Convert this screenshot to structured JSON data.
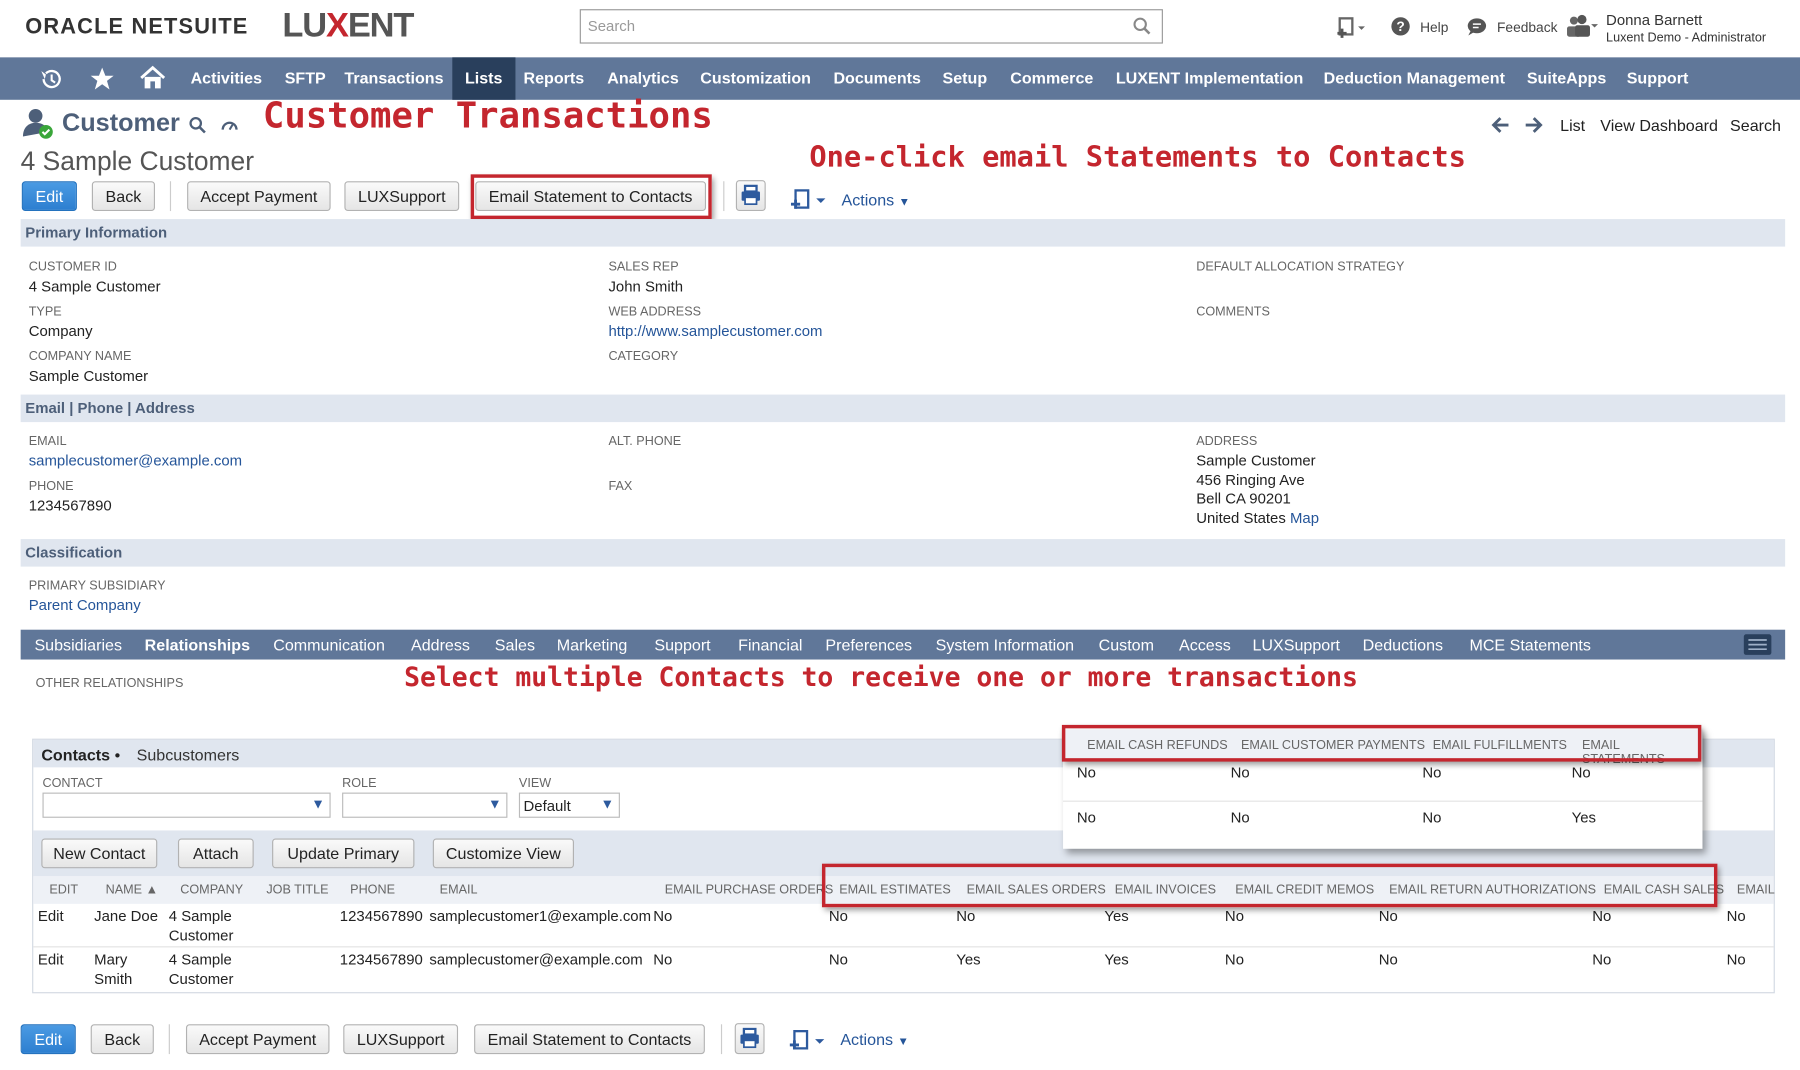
{
  "brand": {
    "oracle": "ORACLE NETSUITE",
    "luxent_pre": "LU",
    "luxent_x": "X",
    "luxent_post": "ENT"
  },
  "search": {
    "placeholder": "Search"
  },
  "topbar": {
    "help": "Help",
    "feedback": "Feedback",
    "user_name": "Donna Barnett",
    "user_role": "Luxent Demo - Administrator"
  },
  "nav": [
    "Activities",
    "SFTP",
    "Transactions",
    "Lists",
    "Reports",
    "Analytics",
    "Customization",
    "Documents",
    "Setup",
    "Commerce",
    "LUXENT Implementation",
    "Deduction Management",
    "SuiteApps",
    "Support"
  ],
  "nav_selected": "Lists",
  "annotations": {
    "title": "Customer Transactions",
    "email_button": "One-click email Statements to Contacts",
    "contacts": "Select multiple Contacts to  receive one or more transactions"
  },
  "page": {
    "type": "Customer",
    "record": "4 Sample Customer"
  },
  "page_links": {
    "list": "List",
    "dashboard": "View Dashboard",
    "search": "Search"
  },
  "buttons": {
    "edit": "Edit",
    "back": "Back",
    "accept": "Accept Payment",
    "luxsupport": "LUXSupport",
    "email_statement": "Email Statement to Contacts",
    "actions": "Actions"
  },
  "primary": {
    "section": "Primary Information",
    "customer_id_label": "CUSTOMER ID",
    "customer_id": "4 Sample Customer",
    "type_label": "TYPE",
    "type": "Company",
    "company_name_label": "COMPANY NAME",
    "company_name": "Sample Customer",
    "sales_rep_label": "SALES REP",
    "sales_rep": "John Smith",
    "web_label": "WEB ADDRESS",
    "web": "http://www.samplecustomer.com",
    "category_label": "CATEGORY",
    "alloc_label": "DEFAULT ALLOCATION STRATEGY",
    "comments_label": "COMMENTS"
  },
  "contact_info": {
    "section": "Email | Phone | Address",
    "email_label": "EMAIL",
    "email": "samplecustomer@example.com",
    "phone_label": "PHONE",
    "phone": "1234567890",
    "alt_phone_label": "ALT. PHONE",
    "fax_label": "FAX",
    "address_label": "ADDRESS",
    "address_1": "Sample Customer",
    "address_2": "456 Ringing Ave",
    "address_3": "Bell CA 90201",
    "address_4": "United States",
    "map": "Map"
  },
  "classification": {
    "section": "Classification",
    "subsidiary_label": "PRIMARY SUBSIDIARY",
    "subsidiary": "Parent Company"
  },
  "subtabs": [
    "Subsidiaries",
    "Relationships",
    "Communication",
    "Address",
    "Sales",
    "Marketing",
    "Support",
    "Financial",
    "Preferences",
    "System Information",
    "Custom",
    "Access",
    "LUXSupport",
    "Deductions",
    "MCE Statements"
  ],
  "subtab_selected": "Relationships",
  "other_relationships": "OTHER RELATIONSHIPS",
  "contacts_tabs": {
    "contacts": "Contacts",
    "dot": "•",
    "subcustomers": "Subcustomers"
  },
  "filters": {
    "contact_label": "CONTACT",
    "role_label": "ROLE",
    "view_label": "VIEW",
    "view_value": "Default"
  },
  "contact_buttons": {
    "new": "New Contact",
    "attach": "Attach",
    "update_primary": "Update Primary",
    "customize": "Customize View"
  },
  "columns": [
    "EDIT",
    "NAME ▲",
    "COMPANY",
    "JOB TITLE",
    "PHONE",
    "EMAIL",
    "EMAIL PURCHASE ORDERS",
    "EMAIL ESTIMATES",
    "EMAIL SALES ORDERS",
    "EMAIL INVOICES",
    "EMAIL CREDIT MEMOS",
    "EMAIL RETURN AUTHORIZATIONS",
    "EMAIL CASH SALES",
    "EMAIL"
  ],
  "rows": [
    {
      "edit": "Edit",
      "name1": "Jane Doe",
      "name2": "",
      "company1": "4 Sample",
      "company2": "Customer",
      "phone": "1234567890",
      "email": "samplecustomer1@example.com",
      "po": "No",
      "est": "No",
      "so": "No",
      "inv": "Yes",
      "cm": "No",
      "ra": "No",
      "cs": "No",
      "last": "No"
    },
    {
      "edit": "Edit",
      "name1": "Mary",
      "name2": "Smith",
      "company1": "4 Sample",
      "company2": "Customer",
      "phone": "1234567890",
      "email": "samplecustomer@example.com",
      "po": "No",
      "est": "No",
      "so": "Yes",
      "inv": "Yes",
      "cm": "No",
      "ra": "No",
      "cs": "No",
      "last": "No"
    }
  ],
  "popup": {
    "columns": [
      "EMAIL CASH REFUNDS",
      "EMAIL CUSTOMER PAYMENTS",
      "EMAIL FULFILLMENTS",
      "EMAIL STATEMENTS"
    ],
    "rows": [
      [
        "No",
        "No",
        "No",
        "No"
      ],
      [
        "No",
        "No",
        "No",
        "Yes"
      ]
    ]
  },
  "colors": {
    "nav": "#607799",
    "nav_selected": "#293f5c",
    "accent_red": "#c4262e",
    "link": "#255599"
  }
}
